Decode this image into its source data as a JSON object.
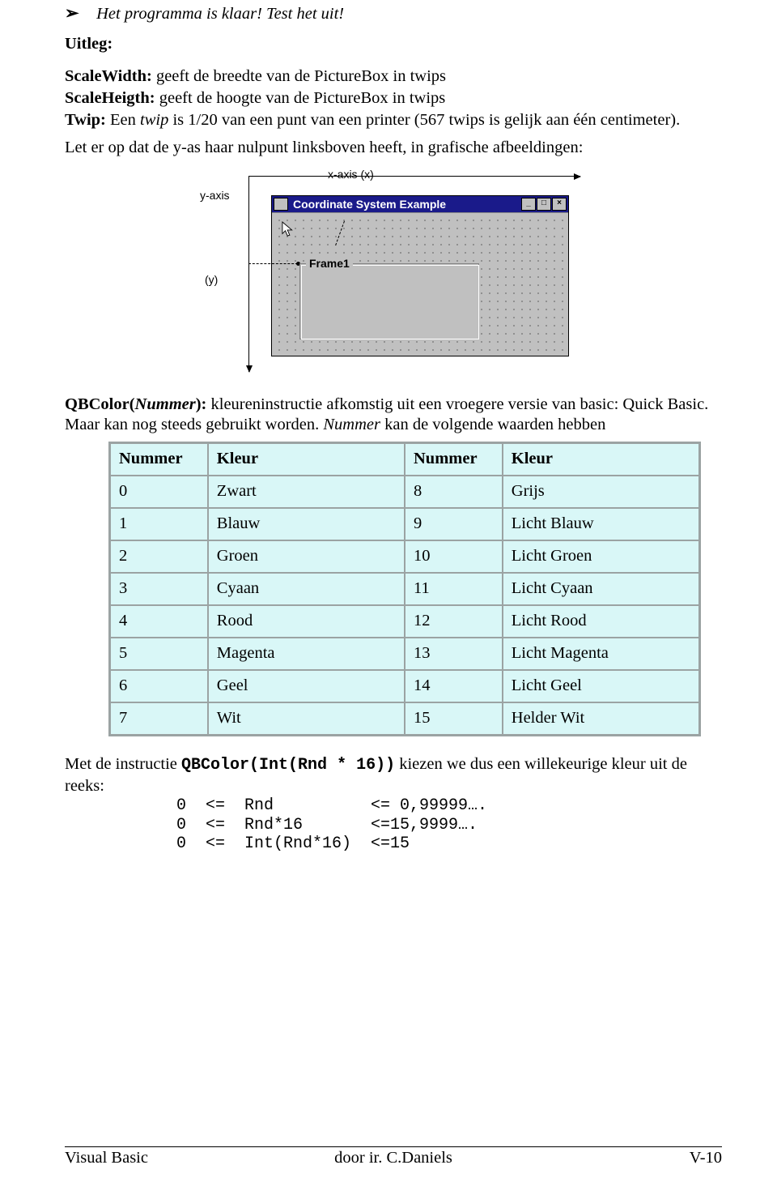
{
  "bullet": "Het programma is klaar! Test het uit!",
  "uitleg_heading": "Uitleg:",
  "defs": {
    "scalewidth_label": "ScaleWidth:",
    "scalewidth_body": " geeft de breedte van de PictureBox in twips",
    "scaleheigth_label": "ScaleHeigth:",
    "scaleheigth_body": " geeft de hoogte van de PictureBox in twips",
    "twip_label": "Twip:",
    "twip_prefix": " Een ",
    "twip_word": "twip",
    "twip_body": " is 1/20 van een punt van een printer (567 twips is gelijk aan één centimeter)."
  },
  "yaxis_note": "Let er op dat de y-as haar nulpunt linksboven heeft, in grafische afbeeldingen:",
  "diagram": {
    "xaxis": "x-axis (x)",
    "yaxis": "y-axis",
    "y_paren": "(y)",
    "window_title": "Coordinate System Example",
    "frame_label": "Frame1"
  },
  "qbcolor": {
    "label": "QBColor(",
    "param": "Nummer",
    "label_tail": "):",
    "body1": " kleureninstructie afkomstig uit een vroegere versie van basic: Quick Basic. Maar kan nog steeds gebruikt worden. ",
    "param2": "Nummer",
    "body2": " kan de volgende waarden hebben"
  },
  "table": {
    "headers": [
      "Nummer",
      "Kleur",
      "Nummer",
      "Kleur"
    ],
    "rows": [
      [
        "0",
        "Zwart",
        "8",
        "Grijs"
      ],
      [
        "1",
        "Blauw",
        "9",
        "Licht Blauw"
      ],
      [
        "2",
        "Groen",
        "10",
        "Licht Groen"
      ],
      [
        "3",
        "Cyaan",
        "11",
        "Licht Cyaan"
      ],
      [
        "4",
        "Rood",
        "12",
        "Licht Rood"
      ],
      [
        "5",
        "Magenta",
        "13",
        "Licht Magenta"
      ],
      [
        "6",
        "Geel",
        "14",
        "Licht Geel"
      ],
      [
        "7",
        "Wit",
        "15",
        "Helder Wit"
      ]
    ]
  },
  "post": {
    "pre": "Met de instructie ",
    "code": "QBColor(Int(Rnd * 16))",
    "post": "   kiezen we dus een willekeurige kleur uit de reeks:"
  },
  "code_lines": "0  <=  Rnd          <= 0,99999….\n0  <=  Rnd*16       <=15,9999….\n0  <=  Int(Rnd*16)  <=15",
  "footer": {
    "left": "Visual Basic",
    "center": "door ir. C.Daniels",
    "right": "V-10"
  }
}
